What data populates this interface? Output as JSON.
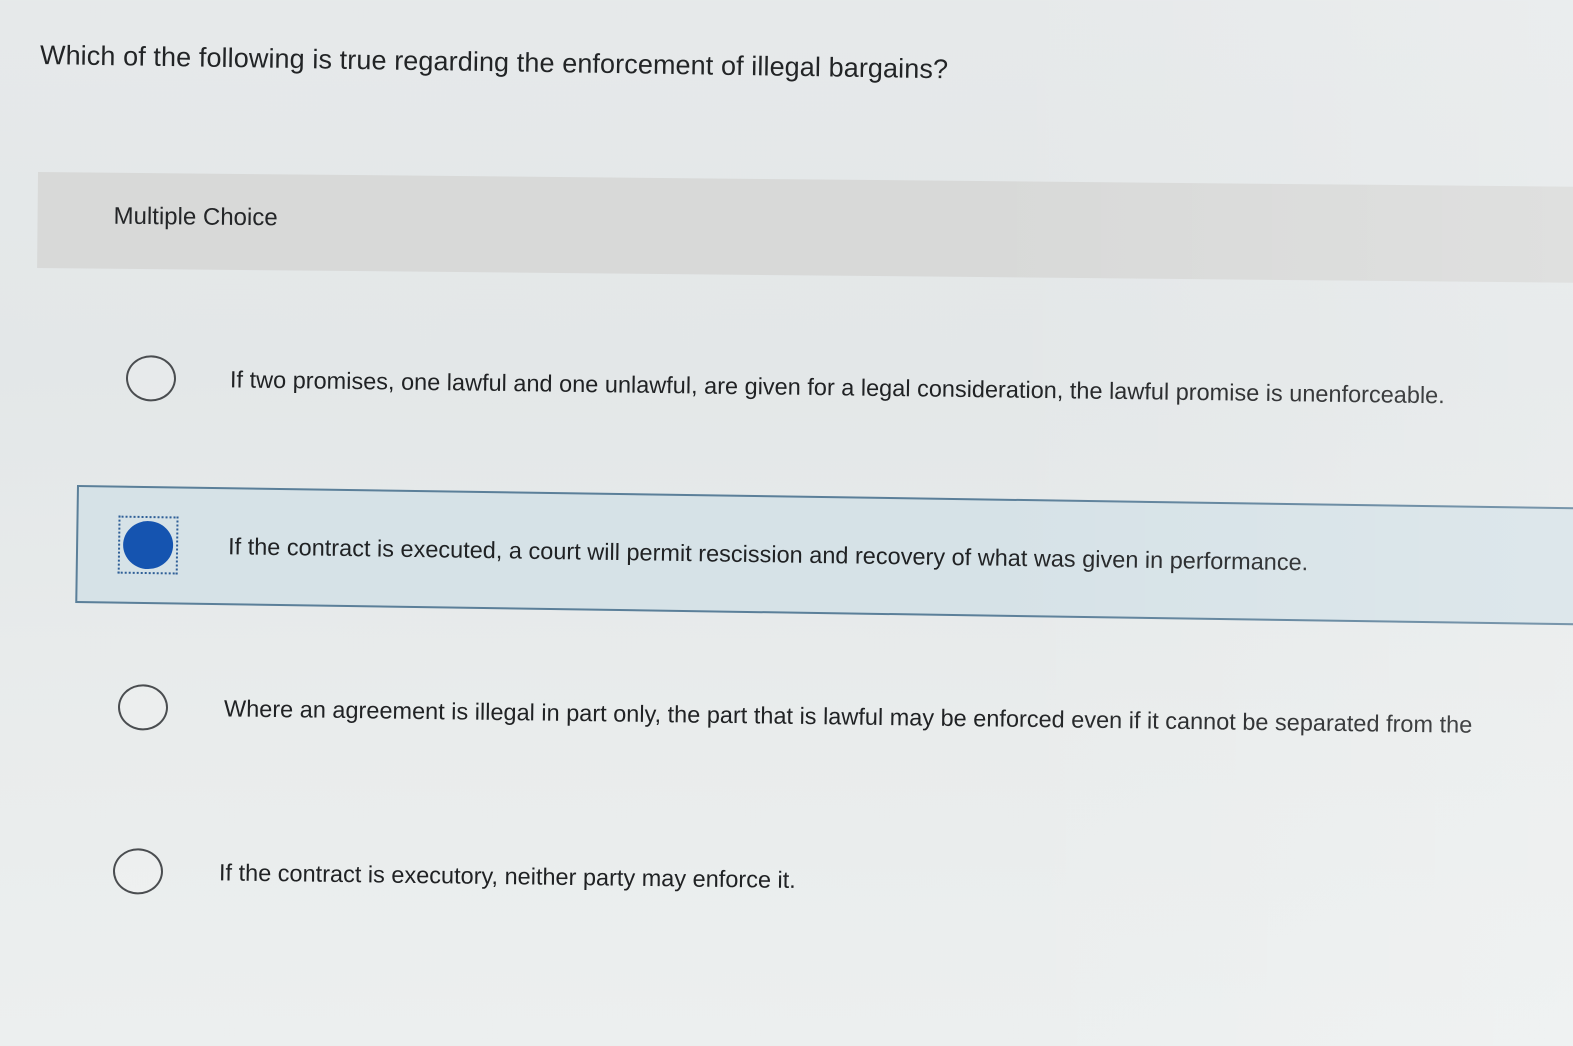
{
  "question": {
    "text": "Which of the following is true regarding the enforcement of illegal bargains?"
  },
  "section": {
    "label": "Multiple Choice"
  },
  "options": [
    {
      "text": "If two promises, one lawful and one unlawful, are given for a legal consideration, the lawful promise is unenforceable.",
      "selected": false
    },
    {
      "text": "If the contract is executed, a court will permit rescission and recovery of what was given in performance.",
      "selected": true
    },
    {
      "text": "Where an agreement is illegal in part only, the part that is lawful may be enforced even if it cannot be separated from the",
      "selected": false
    },
    {
      "text": "If the contract is executory, neither party may enforce it.",
      "selected": false
    }
  ],
  "colors": {
    "selected_fill": "#1554b0",
    "selected_background": "#d6e2e7",
    "selected_border": "#5b7f99",
    "header_background": "#d8d9d8"
  }
}
